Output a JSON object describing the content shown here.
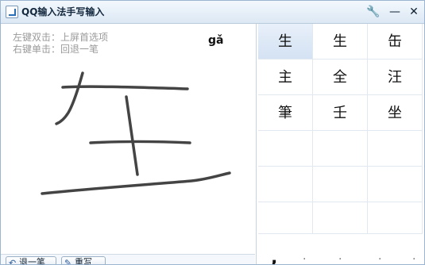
{
  "window": {
    "title": "QQ输入法手写输入",
    "controls": {
      "settings": "🔧",
      "minimize": "—",
      "close": "✕"
    }
  },
  "hints": {
    "line1": "左键双击：上屏首选项",
    "line2": "右键单击：回退一笔"
  },
  "pinyin": "gǎ",
  "candidates": [
    [
      "生",
      "生",
      "缶"
    ],
    [
      "主",
      "全",
      "汪"
    ],
    [
      "筆",
      "壬",
      "坐"
    ]
  ],
  "buttons": {
    "undo": {
      "icon": "↶",
      "label": "退一笔"
    },
    "rewrite": {
      "icon": "✎",
      "label": "重写"
    }
  },
  "bottom_punct": ",",
  "colors": {
    "accent": "#2a6fb5",
    "border": "#9bb4cf"
  }
}
